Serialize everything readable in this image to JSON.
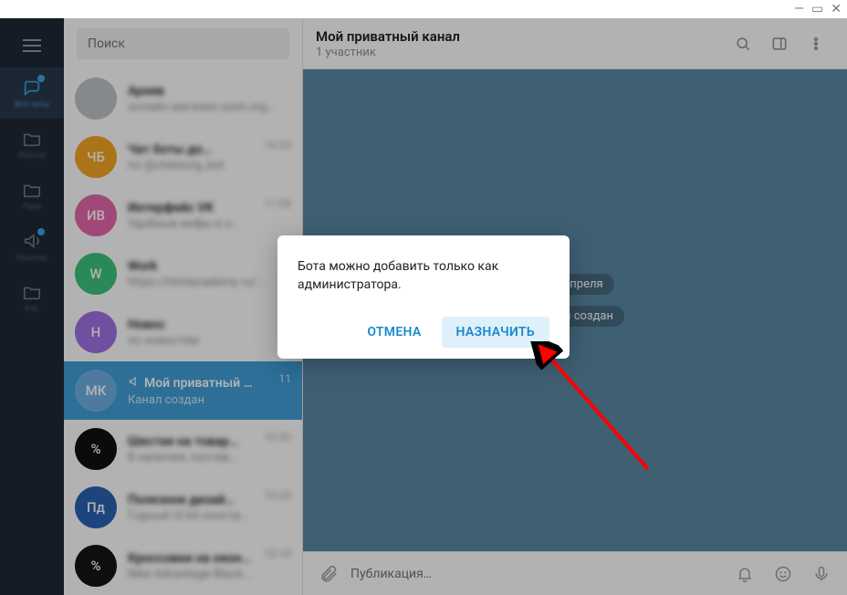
{
  "window_controls": {
    "min": "—",
    "max": "▭",
    "close": "✕"
  },
  "rail": {
    "items": [
      {
        "label": "Все чаты"
      },
      {
        "label": "Работа"
      },
      {
        "label": "Разн"
      },
      {
        "label": "Каналы"
      },
      {
        "label": "Рзс"
      }
    ]
  },
  "search": {
    "placeholder": "Поиск"
  },
  "chat_header": {
    "title": "Мой приватный канал",
    "subtitle": "1 участник"
  },
  "chats": [
    {
      "avatar_bg": "#bfc5cb",
      "avatar_text": "",
      "title": "Архив",
      "sub": "онлайн магазин ozon.org…",
      "time": ""
    },
    {
      "avatar_bg": "#f5a623",
      "avatar_text": "ЧБ",
      "title": "Чат боты до…",
      "sub": "по @chatsorg_bot",
      "time": "14:20"
    },
    {
      "avatar_bg": "#e667ac",
      "avatar_text": "ИВ",
      "title": "Интерфейс VK",
      "sub": "Удобные инфы и о…",
      "time": "11:08"
    },
    {
      "avatar_bg": "#3ec57a",
      "avatar_text": "W",
      "title": "Work",
      "sub": "https://htmlacademy ru/…",
      "time": ""
    },
    {
      "avatar_bg": "#a071e6",
      "avatar_text": "Н",
      "title": "Новоc",
      "sub": "по новостям",
      "time": ""
    },
    {
      "avatar_bg": "#6fb1e4",
      "avatar_text": "МК",
      "title": "Мой приватный …",
      "sub": "Канал создан",
      "time": "11"
    },
    {
      "avatar_bg": "#111",
      "avatar_text": "%",
      "title": "Шестая на товар…",
      "sub": "В наличии, постав…",
      "time": "10:45"
    },
    {
      "avatar_bg": "#2a63b3",
      "avatar_text": "Пд",
      "title": "Полезное дизай…",
      "sub": "Годный UI kit конструктор…",
      "time": "10:20"
    },
    {
      "avatar_bg": "#151515",
      "avatar_text": "%",
      "title": "Кроссовки на окон…",
      "sub": "Nike Advantage Black  Ctas…",
      "time": "10:18"
    }
  ],
  "selected_chat_index": 5,
  "canvas": {
    "date_pill": "24 апреля",
    "system_pill": "Канал создан"
  },
  "composer": {
    "placeholder": "Публикация…"
  },
  "dialog": {
    "message": "Бота можно добавить только как администратора.",
    "cancel": "ОТМЕНА",
    "assign": "НАЗНАЧИТЬ"
  }
}
